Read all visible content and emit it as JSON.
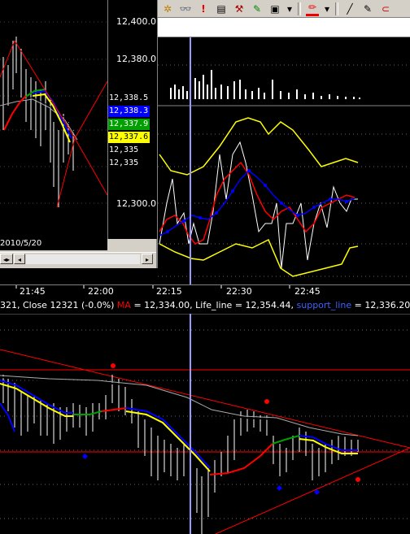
{
  "inset": {
    "axis_labels": [
      "12,400.0",
      "12,380.0",
      "12,300.0"
    ],
    "date_label": "2010/5/20",
    "price_tags": [
      {
        "text": "12,338.5",
        "bg": "#000000",
        "fg": "#ffffff"
      },
      {
        "text": "12,338.3",
        "bg": "#0000ff",
        "fg": "#ffffff"
      },
      {
        "text": "12,337.9",
        "bg": "#00a000",
        "fg": "#ffffff"
      },
      {
        "text": "12,337.6",
        "bg": "#ffff00",
        "fg": "#000000"
      },
      {
        "text": "12,335",
        "bg": "#000000",
        "fg": "#ffffff"
      },
      {
        "text": "12,335",
        "bg": "#000000",
        "fg": "#ffffff"
      }
    ],
    "scroll_left": "◂▸",
    "scroll_prev": "◂",
    "scroll_next": "▸"
  },
  "toolbar": {
    "icons": [
      "gear-icon",
      "glasses-icon",
      "alert-icon",
      "notepad-icon",
      "hammer-icon",
      "wand-icon",
      "chart-icon",
      "dropdown-icon",
      "pen-color-icon",
      "dropdown-icon",
      "line-icon",
      "pencil-icon",
      "magnet-icon"
    ],
    "glyphs": [
      "✲",
      "👓",
      "!",
      "▤",
      "⚒",
      "✎",
      "▣",
      "▾",
      "✏",
      "▾",
      "╱",
      "✎",
      "⊂"
    ]
  },
  "time_axis": {
    "ticks": [
      "21:45",
      "22:00",
      "22:15",
      "22:30",
      "22:45"
    ]
  },
  "legend": {
    "prefix": "321, Close 12321 (-0.0%) ",
    "ma_label": "MA",
    "ma_value": " = 12,334.00, ",
    "life_label": "Life_line",
    "life_value": " = 12,354.44, ",
    "support_label": "support_line",
    "support_value": " = 12,336.20"
  },
  "colors": {
    "ma": "#ff0000",
    "support": "#0000ff",
    "bollinger": "#ffff00",
    "crosshair": "#9999ff"
  }
}
